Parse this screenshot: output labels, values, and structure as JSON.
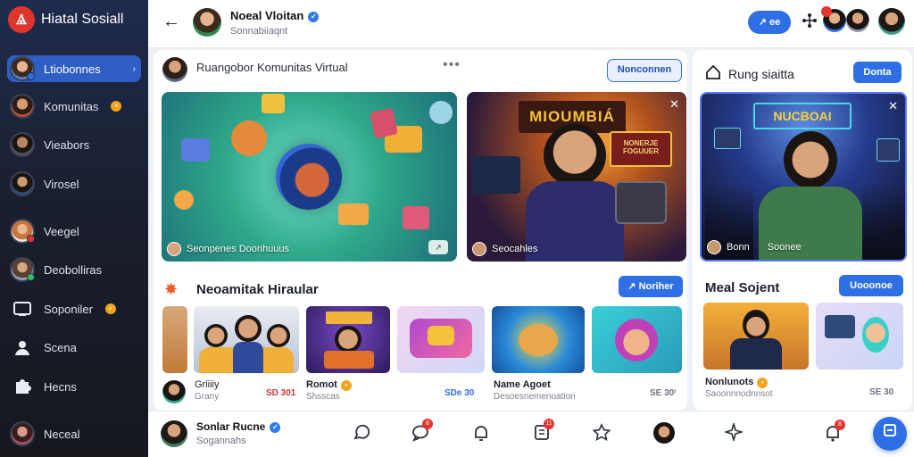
{
  "app": {
    "name": "Hiatal Sosiall"
  },
  "sidebar": {
    "items": [
      {
        "label": "Ltiobonnes",
        "active": true,
        "avatar": "#e7b58f"
      },
      {
        "label": "Komunitas",
        "badge": true,
        "avatar": "#d89a6e"
      },
      {
        "label": "Vieabors",
        "avatar": "#b98763"
      },
      {
        "label": "Virosel",
        "avatar": "#3a5a8a"
      },
      {
        "label": "Veegel",
        "avatar": "#e08e5a"
      },
      {
        "label": "Deobolliras",
        "avatar": "#c7a07b"
      },
      {
        "label": "Soponiler",
        "badge": true,
        "icon": "screen-icon"
      },
      {
        "label": "Scena",
        "icon": "user-icon"
      },
      {
        "label": "Hecns",
        "icon": "puzzle-icon"
      },
      {
        "label": "Neceal",
        "avatar": "#b0545a"
      }
    ]
  },
  "topbar": {
    "name": "Noeal Vloitan",
    "subtitle": "Sonnabiiaqnt",
    "pill": "↗ ee"
  },
  "main": {
    "post_title": "Ruangobor Komunitas Virtual",
    "follow_label": "Nonconnen",
    "cards": [
      {
        "caption": "Seonpenes Doonhuuus"
      },
      {
        "caption": "Seocahles",
        "banner": "MIOUMBIÁ",
        "sign": "NONERJE FOGUUER"
      }
    ],
    "section_title": "Neoamitak Hiraular",
    "section_button": "↗ Noriher",
    "thumbs": [
      {
        "title": "Griiiiy",
        "sub": "Grany",
        "count": "SD 301",
        "count_color": "#d0342c"
      },
      {
        "title": "Romot",
        "badge": true,
        "sub": "Shsscas",
        "count": "",
        "count_color": "#d0342c"
      },
      {
        "title": "",
        "sub": "",
        "count": "SDe 30",
        "count_color": "#2f6fe6"
      },
      {
        "title": "Name Agoet",
        "sub": "Desoesnemenoation",
        "count": "SE 30ʳ",
        "count_color": "#6b7280"
      }
    ]
  },
  "right": {
    "title": "Rung siaitta",
    "top_button": "Donta",
    "stream": {
      "caption": "Bonn",
      "caption2": "Soonee",
      "banner": "NUCBOAI"
    },
    "section_title": "Meal Sojent",
    "section_button": "Uooonoe",
    "item_title": "Nonlunots",
    "item_sub": "Saoonnnodnnsot",
    "item_count": "SE 30"
  },
  "bottom": {
    "name": "Sonlar Rucne",
    "subtitle": "Sogannahs",
    "badges": {
      "chat": "8",
      "docs": "11",
      "bell": "8"
    }
  },
  "colors": {
    "accent": "#2f6fe6",
    "badge": "#e3342f",
    "sidebar": "#1f2b4d"
  }
}
